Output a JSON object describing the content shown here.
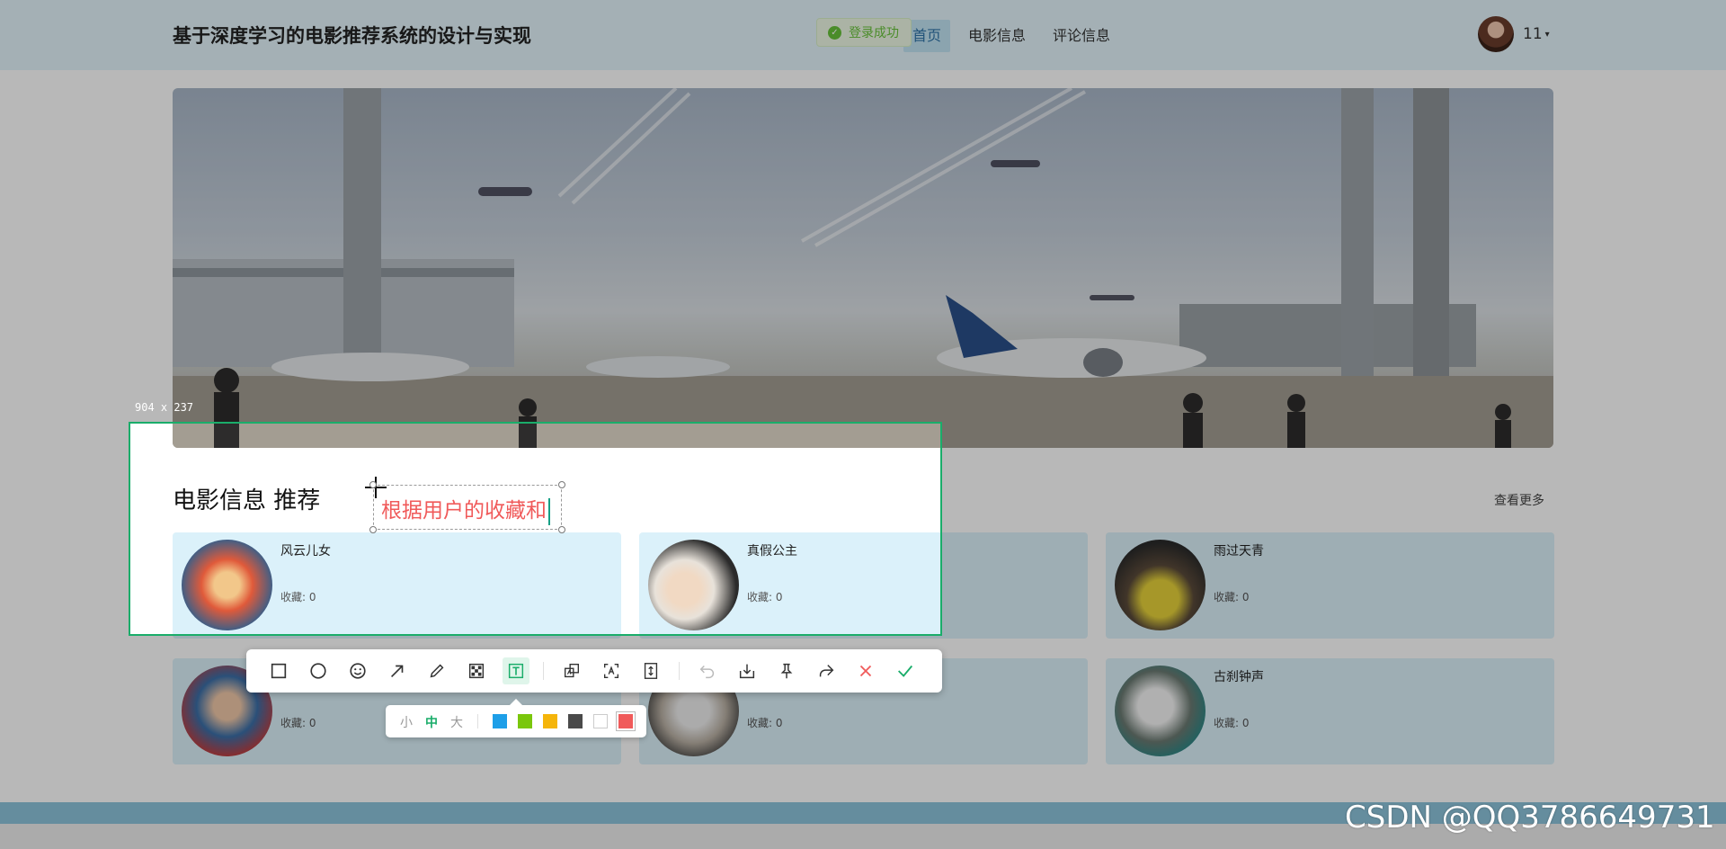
{
  "header": {
    "site_title": "基于深度学习的电影推荐系统的设计与实现",
    "nav": [
      {
        "label": "首页",
        "active": true
      },
      {
        "label": "电影信息",
        "active": false
      },
      {
        "label": "评论信息",
        "active": false
      }
    ],
    "username": "11",
    "caret": "▾"
  },
  "toast": {
    "icon": "check-circle-icon",
    "glyph": "✓",
    "text": "登录成功"
  },
  "section": {
    "title": "电影信息 推荐",
    "more": "查看更多"
  },
  "movies": [
    {
      "name": "风云儿女",
      "fav": "收藏: 0"
    },
    {
      "name": "真假公主",
      "fav": "收藏: 0"
    },
    {
      "name": "雨过天青",
      "fav": "收藏: 0"
    },
    {
      "name": "",
      "fav": "收藏: 0"
    },
    {
      "name": "",
      "fav": "收藏: 0"
    },
    {
      "name": "古刹钟声",
      "fav": "收藏: 0"
    }
  ],
  "screenshot_tool": {
    "size_label": "904 x 237",
    "text_input": "根据用户的收藏和",
    "tools": [
      {
        "name": "rect-tool-icon",
        "active": false
      },
      {
        "name": "circle-tool-icon",
        "active": false
      },
      {
        "name": "emoji-tool-icon",
        "active": false
      },
      {
        "name": "arrow-tool-icon",
        "active": false
      },
      {
        "name": "pencil-tool-icon",
        "active": false
      },
      {
        "name": "mosaic-tool-icon",
        "active": false
      },
      {
        "name": "text-tool-icon",
        "active": true
      },
      {
        "name": "ocr-translate-icon",
        "active": false
      },
      {
        "name": "ocr-text-icon",
        "active": false
      },
      {
        "name": "long-screenshot-icon",
        "active": false
      },
      {
        "name": "undo-icon",
        "active": false
      },
      {
        "name": "save-icon",
        "active": false
      },
      {
        "name": "pin-icon",
        "active": false
      },
      {
        "name": "share-icon",
        "active": false
      },
      {
        "name": "cancel-icon",
        "active": false
      },
      {
        "name": "confirm-icon",
        "active": false
      }
    ],
    "font_sizes": [
      {
        "label": "小",
        "active": false
      },
      {
        "label": "中",
        "active": true
      },
      {
        "label": "大",
        "active": false
      }
    ],
    "colors": [
      "#1e9fe8",
      "#7ac70c",
      "#f5b50a",
      "#4a4a4a",
      "#ffffff",
      "#f05a5a"
    ],
    "selected_color": "#f05a5a"
  },
  "watermark": "CSDN @QQ3786649731"
}
